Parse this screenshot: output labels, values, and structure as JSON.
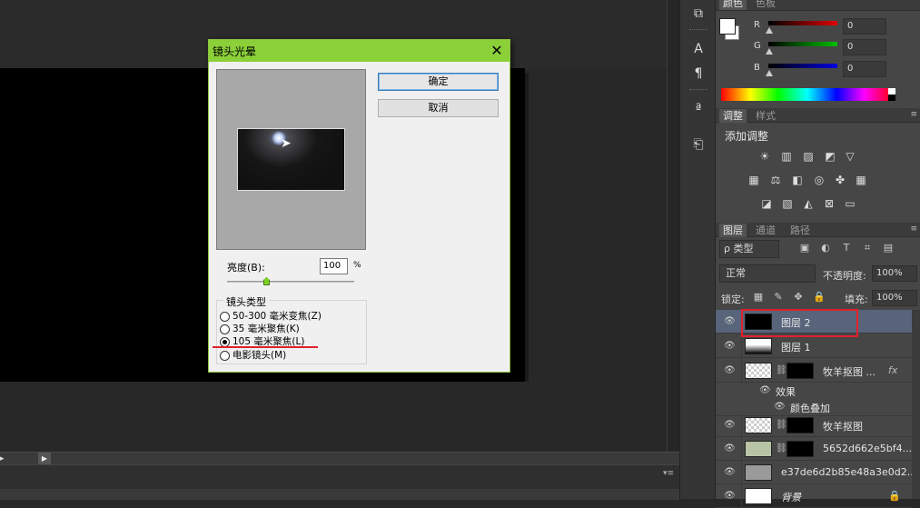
{
  "dialog": {
    "title": "镜头光晕",
    "close_icon": "close-icon",
    "ok_label": "确定",
    "cancel_label": "取消",
    "brightness_label": "亮度(B):",
    "brightness_value": "100",
    "brightness_unit": "%",
    "lens_type_label": "镜头类型",
    "lens_options": [
      {
        "label": "50-300 毫米变焦(Z)",
        "selected": false
      },
      {
        "label": "35 毫米聚焦(K)",
        "selected": false
      },
      {
        "label": "105 毫米聚焦(L)",
        "selected": true
      },
      {
        "label": "电影镜头(M)",
        "selected": false
      }
    ],
    "accent_color": "#8bd039",
    "highlight_color": "#e1202c"
  },
  "color_panel": {
    "tabs": [
      "颜色",
      "色板"
    ],
    "channels": [
      {
        "label": "R",
        "value": "0",
        "color": "#e00000"
      },
      {
        "label": "G",
        "value": "0",
        "color": "#00c000"
      },
      {
        "label": "B",
        "value": "0",
        "color": "#0000e0"
      }
    ]
  },
  "adjust_panel": {
    "tabs": [
      "调整",
      "样式"
    ],
    "title": "添加调整"
  },
  "layers_panel": {
    "tabs": [
      "图层",
      "通道",
      "路径"
    ],
    "filter_label": "ρ 类型",
    "blend_mode": "正常",
    "opacity_label": "不透明度:",
    "opacity_value": "100%",
    "lock_label": "锁定:",
    "fill_label": "填充:",
    "fill_value": "100%",
    "layers": [
      {
        "name": "图层 2",
        "selected": true
      },
      {
        "name": "图层 1",
        "selected": false
      },
      {
        "name": "牧羊抠图 ...",
        "fx": "fx",
        "selected": false
      },
      {
        "name": "效果",
        "sub": true
      },
      {
        "name": "颜色叠加",
        "sub": true
      },
      {
        "name": "牧羊抠图",
        "selected": false
      },
      {
        "name": "5652d662e5bf4...",
        "selected": false
      },
      {
        "name": "e37de6d2b85e48a3e0d2...",
        "selected": false
      },
      {
        "name": "背景",
        "selected": false
      }
    ]
  }
}
